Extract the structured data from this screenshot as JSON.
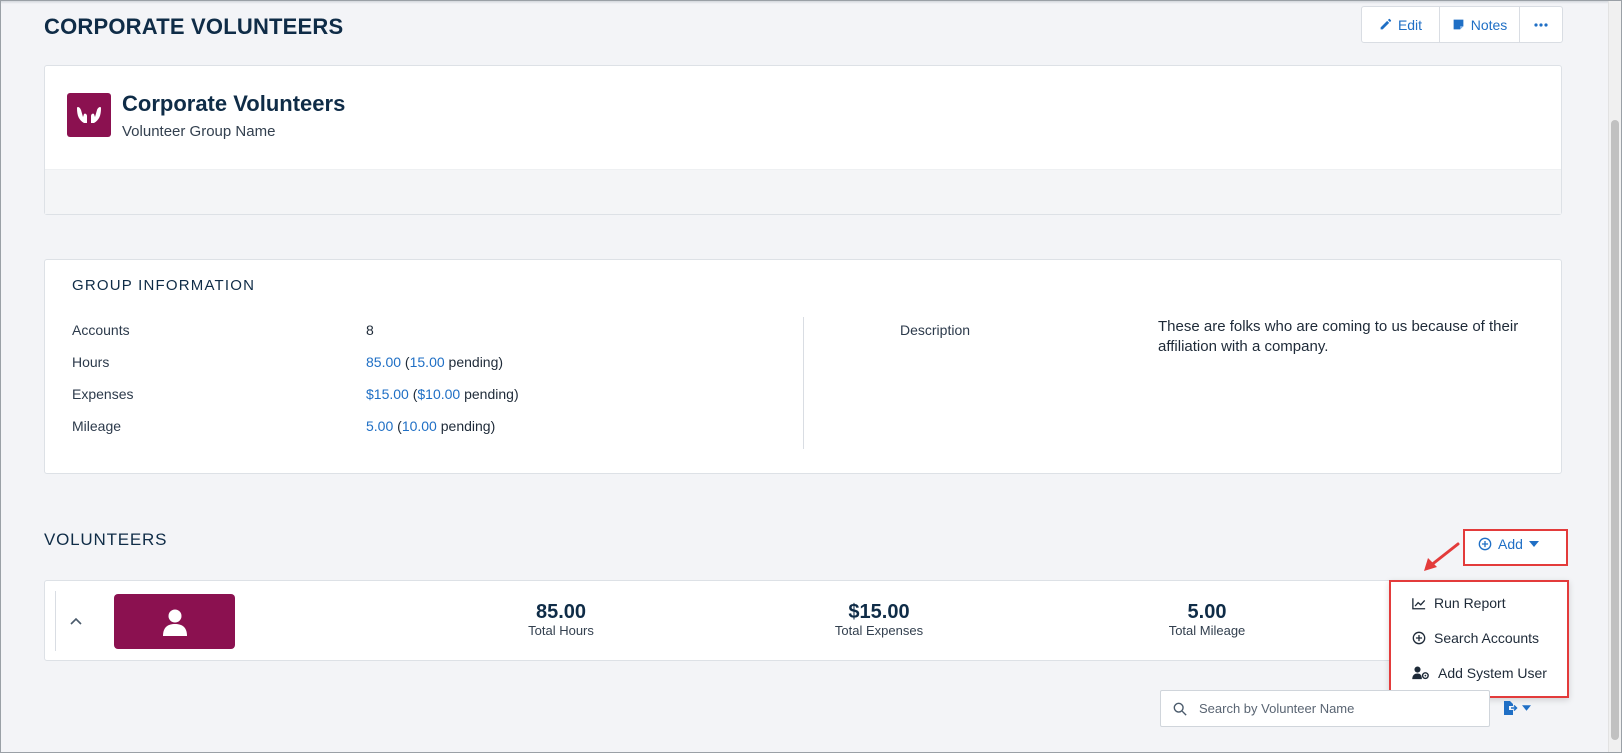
{
  "page": {
    "title": "CORPORATE VOLUNTEERS"
  },
  "toolbar": {
    "edit_label": "Edit",
    "notes_label": "Notes",
    "more_icon": "ellipsis-icon",
    "edit_icon": "pencil-icon",
    "notes_icon": "note-icon"
  },
  "header_card": {
    "name": "Corporate Volunteers",
    "subtitle": "Volunteer Group Name",
    "logo_icon": "hands-icon"
  },
  "group_info": {
    "title": "GROUP INFORMATION",
    "rows": [
      {
        "label": "Accounts",
        "value": "8"
      },
      {
        "label": "Hours",
        "value": "85.00",
        "pending_value": "15.00",
        "pending_label": "pending"
      },
      {
        "label": "Expenses",
        "value": "$15.00",
        "pending_value": "$10.00",
        "pending_label": "pending"
      },
      {
        "label": "Mileage",
        "value": "5.00",
        "pending_value": "10.00",
        "pending_label": "pending"
      }
    ],
    "description_label": "Description",
    "description_text": "These are folks who are coming to us because of their affiliation with a company."
  },
  "volunteers": {
    "title": "VOLUNTEERS",
    "add_label": "Add",
    "summary": [
      {
        "value": "85.00",
        "label": "Total Hours"
      },
      {
        "value": "$15.00",
        "label": "Total Expenses"
      },
      {
        "value": "5.00",
        "label": "Total Mileage"
      }
    ],
    "add_menu": [
      {
        "label": "Run Report",
        "icon": "line-chart-icon"
      },
      {
        "label": "Search Accounts",
        "icon": "plus-circle-icon"
      },
      {
        "label": "Add System User",
        "icon": "user-gear-icon"
      }
    ],
    "search_placeholder": "Search by Volunteer Name"
  },
  "colors": {
    "brand": "#8b1150",
    "link": "#1f6fc5",
    "heading": "#0f2c47",
    "highlight": "#e33b3b"
  }
}
